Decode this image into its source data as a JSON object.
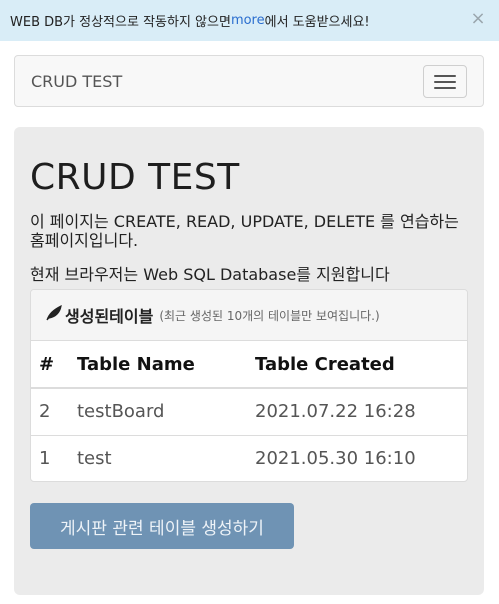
{
  "alert": {
    "text_before": "WEB DB가 정상적으로 작동하지 않으면 ",
    "link": "more",
    "text_after": "에서 도움받으세요!",
    "close": "×"
  },
  "navbar": {
    "brand": "CRUD TEST"
  },
  "jumbotron": {
    "title": "CRUD TEST",
    "desc_prefix": "이 페이지는 ",
    "desc_ops": "CREATE, READ, UPDATE, DELETE",
    "desc_suffix": " 를 연습하는 홈페이지입니다.",
    "support_prefix": "현재 브라우저는 ",
    "support_db": "Web SQL Database",
    "support_suffix": "를 지원합니다"
  },
  "panel": {
    "leaf_icon": "leaf-icon",
    "title": "생성된테이블",
    "subtitle": "(최근 생성된 10개의 테이블만 보여집니다.)",
    "columns": [
      "#",
      "Table Name",
      "Table Created"
    ],
    "rows": [
      [
        "2",
        "testBoard",
        "2021.07.22 16:28"
      ],
      [
        "1",
        "test",
        "2021.05.30 16:10"
      ]
    ]
  },
  "actions": {
    "create_button": "게시판 관련 테이블 생성하기"
  }
}
